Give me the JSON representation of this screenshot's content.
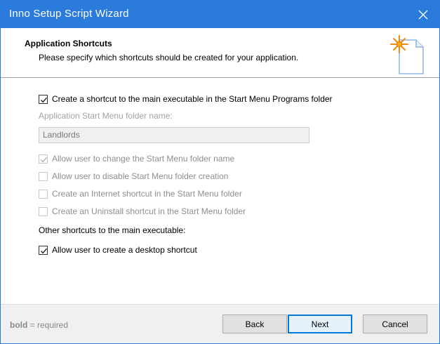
{
  "window": {
    "title": "Inno Setup Script Wizard"
  },
  "header": {
    "title": "Application Shortcuts",
    "subtitle": "Please specify which shortcuts should be created for your application."
  },
  "options": {
    "start_menu_shortcut": {
      "label": "Create a shortcut to the main executable in the Start Menu Programs folder",
      "checked": true,
      "enabled": true
    },
    "folder_name_label": "Application Start Menu folder name:",
    "folder_name_value": "Landlords",
    "allow_change_folder": {
      "label": "Allow user to change the Start Menu folder name",
      "checked": true,
      "enabled": false
    },
    "allow_disable_folder": {
      "label": "Allow user to disable Start Menu folder creation",
      "checked": false,
      "enabled": false
    },
    "internet_shortcut": {
      "label": "Create an Internet shortcut in the Start Menu folder",
      "checked": false,
      "enabled": false
    },
    "uninstall_shortcut": {
      "label": "Create an Uninstall shortcut in the Start Menu folder",
      "checked": false,
      "enabled": false
    },
    "other_shortcuts_label": "Other shortcuts to the main executable:",
    "desktop_shortcut": {
      "label": "Allow user to create a desktop shortcut",
      "checked": true,
      "enabled": true
    }
  },
  "footer": {
    "legend_bold": "bold",
    "legend_rest": " = required",
    "back_label": "Back",
    "next_label": "Next",
    "cancel_label": "Cancel"
  },
  "colors": {
    "titlebar": "#2b7bdc",
    "accent": "#0078d7",
    "footer": "#f0f0f0"
  }
}
